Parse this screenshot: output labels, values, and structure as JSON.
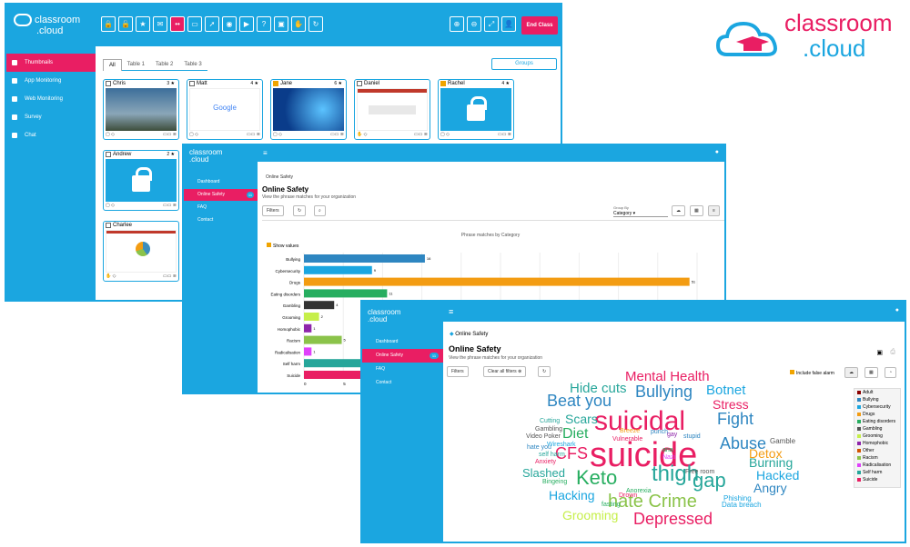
{
  "brand": {
    "name_top": "classroom",
    "name_bottom": ".cloud"
  },
  "window1": {
    "sidebar": [
      {
        "label": "Thumbnails",
        "active": true
      },
      {
        "label": "App Monitoring"
      },
      {
        "label": "Web Monitoring"
      },
      {
        "label": "Survey"
      },
      {
        "label": "Chat"
      }
    ],
    "end_class": "End Class",
    "tabs": [
      "All",
      "Table 1",
      "Table 2",
      "Table 3"
    ],
    "groups": "Groups",
    "students": [
      {
        "name": "Chris",
        "count": "3",
        "checked": false,
        "screen": "desktop"
      },
      {
        "name": "Matt",
        "count": "4",
        "checked": false,
        "screen": "google"
      },
      {
        "name": "Jane",
        "count": "6",
        "checked": true,
        "screen": "windows"
      },
      {
        "name": "Daniel",
        "count": "",
        "checked": false,
        "screen": "app"
      },
      {
        "name": "Rachel",
        "count": "4",
        "checked": true,
        "screen": "locked"
      },
      {
        "name": "Andrew",
        "count": "2",
        "checked": false,
        "screen": "locked"
      },
      {
        "name": "Charlee",
        "count": "",
        "checked": false,
        "screen": "doc"
      }
    ],
    "google_text": "Google"
  },
  "window2": {
    "nav": [
      {
        "label": "Dashboard"
      },
      {
        "label": "Online Safety",
        "badge": "11",
        "active": true
      },
      {
        "label": "FAQ"
      },
      {
        "label": "Contact"
      }
    ],
    "breadcrumb": "Online Safety",
    "title": "Online Safety",
    "subtitle": "View the phrase matches for your organization",
    "filters": "Filters",
    "group_by_label": "Group By",
    "group_by_value": "Category",
    "show_values": "Show values",
    "chart_title": "Phrase matches by Category",
    "x_ticks": [
      "0",
      "5"
    ]
  },
  "chart_data": {
    "type": "bar",
    "title": "Phrase matches by Category",
    "categories": [
      "Bullying",
      "Cybersecurity",
      "Drugs",
      "Eating disorders",
      "Gambling",
      "Grooming",
      "Homophobic",
      "Racism",
      "Radicalisation",
      "Self harm",
      "Suicide"
    ],
    "values": [
      16,
      9,
      51,
      11,
      4,
      2,
      1,
      5,
      1,
      null,
      null
    ],
    "colors": [
      "#2e86c1",
      "#1ba6e0",
      "#f39c12",
      "#27ae60",
      "#333333",
      "#c6ef4a",
      "#8e24aa",
      "#8bc34a",
      "#e040fb",
      "#26a69a",
      "#e91e63"
    ],
    "xlim": [
      0,
      52
    ]
  },
  "window3": {
    "nav": [
      {
        "label": "Dashboard"
      },
      {
        "label": "Online Safety",
        "badge": "11",
        "active": true
      },
      {
        "label": "FAQ"
      },
      {
        "label": "Contact"
      }
    ],
    "breadcrumb": "Online Safety",
    "title": "Online Safety",
    "subtitle": "View the phrase matches for your organization",
    "filters": "Filters",
    "clear_filters": "Clear all filters",
    "include_false": "Include false alarm",
    "legend": [
      {
        "label": "Adult",
        "color": "#8b0000"
      },
      {
        "label": "Bullying",
        "color": "#2e86c1"
      },
      {
        "label": "Cybersecurity",
        "color": "#1ba6e0"
      },
      {
        "label": "Drugs",
        "color": "#f39c12"
      },
      {
        "label": "Eating disorders",
        "color": "#27ae60"
      },
      {
        "label": "Gambling",
        "color": "#555555"
      },
      {
        "label": "Grooming",
        "color": "#c6ef4a"
      },
      {
        "label": "Homophobic",
        "color": "#8e24aa"
      },
      {
        "label": "Other",
        "color": "#d35400"
      },
      {
        "label": "Racism",
        "color": "#8bc34a"
      },
      {
        "label": "Radicalisation",
        "color": "#e040fb"
      },
      {
        "label": "Self harm",
        "color": "#26a69a"
      },
      {
        "label": "Suicide",
        "color": "#e91e63"
      }
    ],
    "words": [
      {
        "t": "suicide",
        "c": "#e91e63",
        "s": 38
      },
      {
        "t": "suicidal",
        "c": "#e91e63",
        "s": 30
      },
      {
        "t": "thigh",
        "c": "#26a69a",
        "s": 24
      },
      {
        "t": "gap",
        "c": "#26a69a",
        "s": 22
      },
      {
        "t": "Keto",
        "c": "#27ae60",
        "s": 22
      },
      {
        "t": "hate Crime",
        "c": "#8bc34a",
        "s": 20
      },
      {
        "t": "Depressed",
        "c": "#e91e63",
        "s": 18
      },
      {
        "t": "Beat you",
        "c": "#2e86c1",
        "s": 18
      },
      {
        "t": "Bullying",
        "c": "#2e86c1",
        "s": 18
      },
      {
        "t": "Abuse",
        "c": "#2e86c1",
        "s": 18
      },
      {
        "t": "Fight",
        "c": "#2e86c1",
        "s": 18
      },
      {
        "t": "Mental Health",
        "c": "#e91e63",
        "s": 15
      },
      {
        "t": "Hide cuts",
        "c": "#26a69a",
        "s": 15
      },
      {
        "t": "Botnet",
        "c": "#1ba6e0",
        "s": 15
      },
      {
        "t": "Stress",
        "c": "#e91e63",
        "s": 14
      },
      {
        "t": "Diet",
        "c": "#27ae60",
        "s": 16
      },
      {
        "t": "CFS",
        "c": "#e91e63",
        "s": 18
      },
      {
        "t": "Scars",
        "c": "#26a69a",
        "s": 14
      },
      {
        "t": "Detox",
        "c": "#f39c12",
        "s": 14
      },
      {
        "t": "Burning",
        "c": "#26a69a",
        "s": 14
      },
      {
        "t": "Hacked",
        "c": "#1ba6e0",
        "s": 14
      },
      {
        "t": "Angry",
        "c": "#2e86c1",
        "s": 14
      },
      {
        "t": "Slashed",
        "c": "#26a69a",
        "s": 13
      },
      {
        "t": "Hacking",
        "c": "#1ba6e0",
        "s": 14
      },
      {
        "t": "Grooming",
        "c": "#c6ef4a",
        "s": 14
      },
      {
        "t": "Data breach",
        "c": "#1ba6e0",
        "s": 8
      },
      {
        "t": "Phishing",
        "c": "#1ba6e0",
        "s": 8
      },
      {
        "t": "Gamble",
        "c": "#555555",
        "s": 8
      },
      {
        "t": "stupid",
        "c": "#2e86c1",
        "s": 7
      },
      {
        "t": "punch",
        "c": "#2e86c1",
        "s": 7
      },
      {
        "t": "gay",
        "c": "#8e24aa",
        "s": 7
      },
      {
        "t": "Breeze",
        "c": "#f39c12",
        "s": 7
      },
      {
        "t": "Vulnerable",
        "c": "#e91e63",
        "s": 7
      },
      {
        "t": "Cutting",
        "c": "#26a69a",
        "s": 7
      },
      {
        "t": "Gambling",
        "c": "#555555",
        "s": 7
      },
      {
        "t": "Video Poker",
        "c": "#555555",
        "s": 7
      },
      {
        "t": "Wireshark",
        "c": "#1ba6e0",
        "s": 7
      },
      {
        "t": "hate you",
        "c": "#2e86c1",
        "s": 7
      },
      {
        "t": "self harm",
        "c": "#26a69a",
        "s": 7
      },
      {
        "t": "Anxiety",
        "c": "#e91e63",
        "s": 7
      },
      {
        "t": "Free room",
        "c": "#555555",
        "s": 7
      },
      {
        "t": "Bingeing",
        "c": "#27ae60",
        "s": 7
      },
      {
        "t": "Anorexia",
        "c": "#27ae60",
        "s": 7
      },
      {
        "t": "Drown",
        "c": "#e91e63",
        "s": 7
      },
      {
        "t": "fasting",
        "c": "#27ae60",
        "s": 7
      },
      {
        "t": "ana",
        "c": "#27ae60",
        "s": 7
      },
      {
        "t": "Nazi",
        "c": "#e040fb",
        "s": 7
      }
    ]
  }
}
